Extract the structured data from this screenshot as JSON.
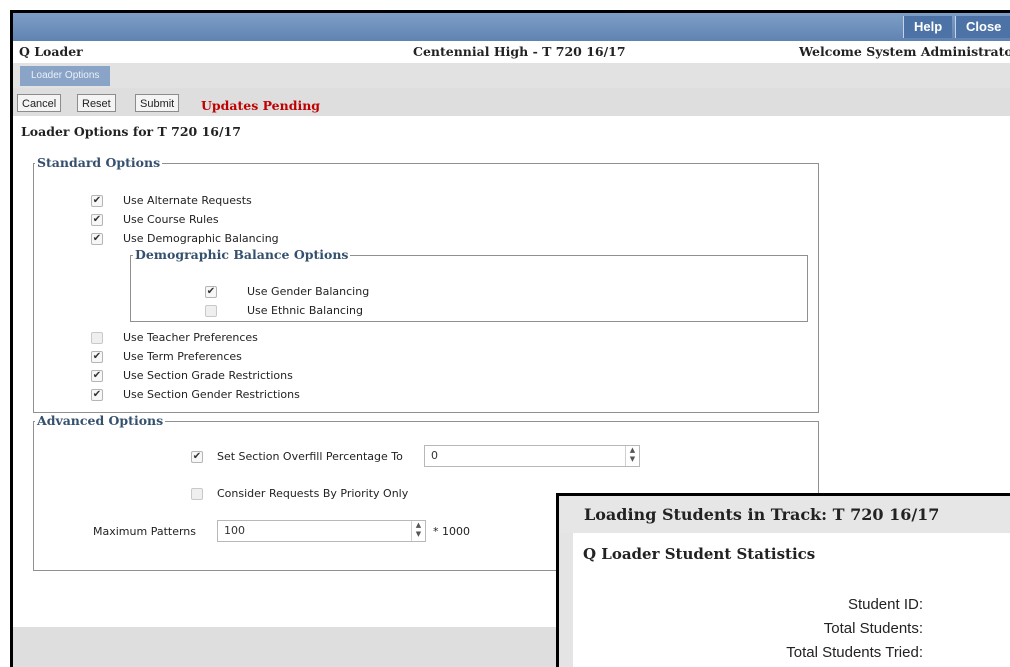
{
  "topbar": {
    "help_label": "Help",
    "close_label": "Close"
  },
  "header": {
    "app_name": "Q Loader",
    "school": "Centennial High - T 720 16/17",
    "welcome": "Welcome System Administrator"
  },
  "tabs": [
    {
      "label": "Loader Options"
    }
  ],
  "toolbar": {
    "cancel_label": "Cancel",
    "reset_label": "Reset",
    "submit_label": "Submit",
    "status": "Updates Pending"
  },
  "page_title": "Loader Options for T 720 16/17",
  "standard_options": {
    "legend": "Standard Options",
    "items": [
      {
        "label": "Use Alternate Requests",
        "checked": true
      },
      {
        "label": "Use Course Rules",
        "checked": true
      },
      {
        "label": "Use Demographic Balancing",
        "checked": true
      }
    ],
    "demographic": {
      "legend": "Demographic Balance Options",
      "items": [
        {
          "label": "Use Gender Balancing",
          "checked": true
        },
        {
          "label": "Use Ethnic Balancing",
          "checked": false
        }
      ]
    },
    "items_after": [
      {
        "label": "Use Teacher Preferences",
        "checked": false
      },
      {
        "label": "Use Term Preferences",
        "checked": true
      },
      {
        "label": "Use Section Grade Restrictions",
        "checked": true
      },
      {
        "label": "Use Section Gender Restrictions",
        "checked": true
      }
    ]
  },
  "advanced_options": {
    "legend": "Advanced Options",
    "overfill": {
      "label": "Set Section Overfill Percentage To",
      "checked": true,
      "value": "0"
    },
    "priority": {
      "label": "Consider Requests By Priority Only",
      "checked": false
    },
    "max_patterns": {
      "label": "Maximum Patterns",
      "value": "100",
      "suffix": "* 1000"
    }
  },
  "overlay": {
    "title": "Loading Students in Track: T 720 16/17",
    "subtitle": "Q Loader Student Statistics",
    "labels": [
      "Student ID:",
      "Total Students:",
      "Total Students Tried:"
    ]
  },
  "icons": {
    "check": "✔",
    "spin_up": "▲",
    "spin_down": "▼"
  },
  "colors": {
    "pending": "#c00000",
    "topbar": "#5f83b2",
    "tab": "#8aa4c7"
  }
}
